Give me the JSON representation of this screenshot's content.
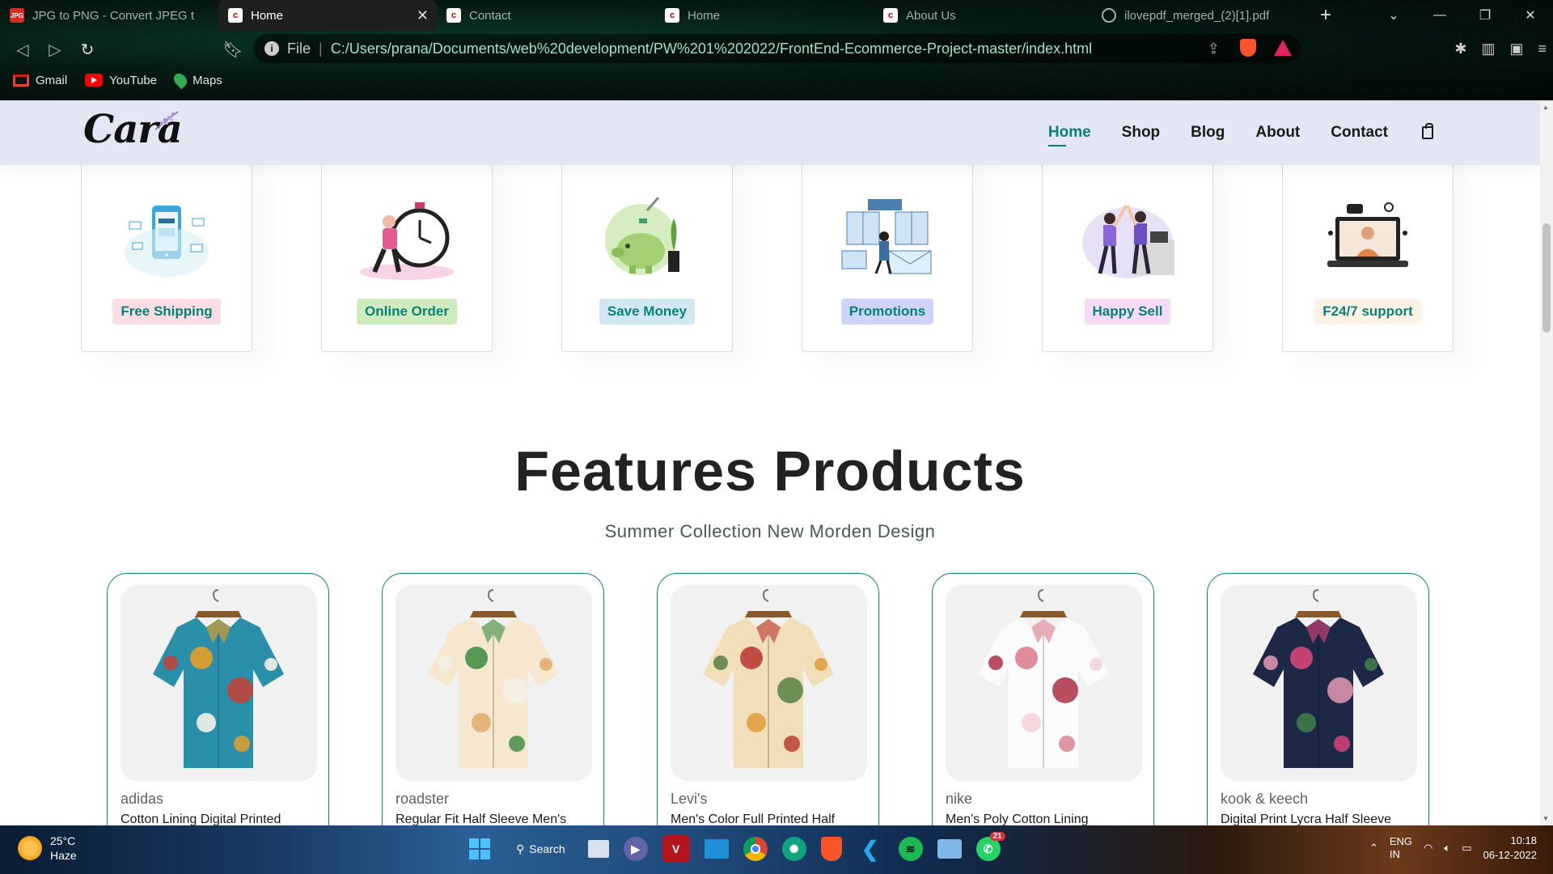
{
  "browser": {
    "tabs": [
      {
        "title": "JPG to PNG - Convert JPEG to P",
        "icon": "jpg-png-favicon",
        "active": false
      },
      {
        "title": "Home",
        "icon": "cara-favicon",
        "active": true
      },
      {
        "title": "Contact",
        "icon": "cara-favicon",
        "active": false
      },
      {
        "title": "Home",
        "icon": "cara-favicon",
        "active": false
      },
      {
        "title": "About Us",
        "icon": "cara-favicon",
        "active": false
      },
      {
        "title": "ilovepdf_merged_(2)[1].pdf",
        "icon": "pdf-globe-favicon",
        "active": false
      }
    ],
    "address": {
      "scheme_label": "File",
      "url": "C:/Users/prana/Documents/web%20development/PW%201%202022/FrontEnd-Ecommerce-Project-master/index.html"
    },
    "bookmarks": [
      "Gmail",
      "YouTube",
      "Maps"
    ]
  },
  "site": {
    "logo": "Cara",
    "nav": [
      "Home",
      "Shop",
      "Blog",
      "About",
      "Contact"
    ],
    "active_nav": "Home",
    "accent_color": "#088178",
    "features": [
      {
        "label": "Free Shipping",
        "bg": "#fddde4",
        "illus": "phone-payment-illustration"
      },
      {
        "label": "Online Order",
        "bg": "#cdebbc",
        "illus": "clock-runner-illustration"
      },
      {
        "label": "Save Money",
        "bg": "#d1e8f2",
        "illus": "piggy-bank-illustration"
      },
      {
        "label": "Promotions",
        "bg": "#cdd4f8",
        "illus": "promotions-illustration"
      },
      {
        "label": "Happy Sell",
        "bg": "#f6dbf6",
        "illus": "high-five-illustration"
      },
      {
        "label": "F24/7 support",
        "bg": "#fff2e5",
        "illus": "laptop-support-illustration"
      }
    ],
    "section_title": "Features Products",
    "section_subtitle": "Summer Collection New Morden Design",
    "products": [
      {
        "brand": "adidas",
        "name": "Cotton Lining Digital Printed",
        "shirt_colors": [
          "#2a8fa8",
          "#f0a020",
          "#d33a2c",
          "#f4f1e6"
        ]
      },
      {
        "brand": "roadster",
        "name": "Regular Fit Half Sleeve Men's",
        "shirt_colors": [
          "#f6e7cf",
          "#3b8a3e",
          "#f4f1e6",
          "#e0b070"
        ]
      },
      {
        "brand": "Levi's",
        "name": "Men's Color Full Printed Half",
        "shirt_colors": [
          "#f0dfb8",
          "#b8332c",
          "#4d7a3a",
          "#e0a040"
        ]
      },
      {
        "brand": "nike",
        "name": "Men's Poly Cotton Lining",
        "shirt_colors": [
          "#fbfbfb",
          "#d9798a",
          "#a6243a",
          "#f4d4da"
        ]
      },
      {
        "brand": "kook & keech",
        "name": "Digital Print Lycra Half Sleeve",
        "shirt_colors": [
          "#1c2846",
          "#e0467a",
          "#f3a0bc",
          "#3e7a4a"
        ]
      }
    ]
  },
  "taskbar": {
    "weather_temp": "25°C",
    "weather_desc": "Haze",
    "search_label": "Search",
    "lang_top": "ENG",
    "lang_bottom": "IN",
    "time": "10:18",
    "date": "06-12-2022",
    "whatsapp_badge": "21"
  }
}
